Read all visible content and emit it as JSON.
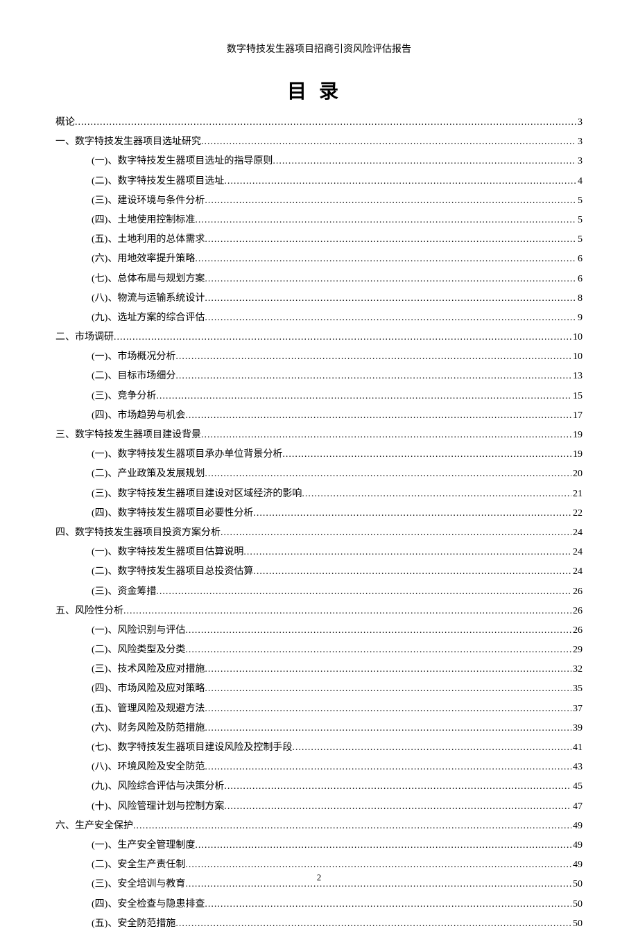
{
  "header": "数字特技发生器项目招商引资风险评估报告",
  "toc_title": "目录",
  "page_number": "2",
  "entries": [
    {
      "level": 0,
      "label": "概论",
      "page": "3"
    },
    {
      "level": 1,
      "label": "一、数字特技发生器项目选址研究",
      "page": "3"
    },
    {
      "level": 2,
      "label": "(一)、数字特技发生器项目选址的指导原则",
      "page": "3"
    },
    {
      "level": 2,
      "label": "(二)、数字特技发生器项目选址",
      "page": "4"
    },
    {
      "level": 2,
      "label": "(三)、建设环境与条件分析",
      "page": "5"
    },
    {
      "level": 2,
      "label": "(四)、土地使用控制标准",
      "page": "5"
    },
    {
      "level": 2,
      "label": "(五)、土地利用的总体需求",
      "page": "5"
    },
    {
      "level": 2,
      "label": "(六)、用地效率提升策略",
      "page": "6"
    },
    {
      "level": 2,
      "label": "(七)、总体布局与规划方案",
      "page": "6"
    },
    {
      "level": 2,
      "label": "(八)、物流与运输系统设计",
      "page": "8"
    },
    {
      "level": 2,
      "label": "(九)、选址方案的综合评估",
      "page": "9"
    },
    {
      "level": 1,
      "label": "二、市场调研",
      "page": "10"
    },
    {
      "level": 2,
      "label": "(一)、市场概况分析",
      "page": "10"
    },
    {
      "level": 2,
      "label": "(二)、目标市场细分",
      "page": "13"
    },
    {
      "level": 2,
      "label": "(三)、竞争分析",
      "page": "15"
    },
    {
      "level": 2,
      "label": "(四)、市场趋势与机会",
      "page": "17"
    },
    {
      "level": 1,
      "label": "三、数字特技发生器项目建设背景",
      "page": "19"
    },
    {
      "level": 2,
      "label": "(一)、数字特技发生器项目承办单位背景分析",
      "page": "19"
    },
    {
      "level": 2,
      "label": "(二)、产业政策及发展规划",
      "page": "20"
    },
    {
      "level": 2,
      "label": "(三)、数字特技发生器项目建设对区域经济的影响",
      "page": "21"
    },
    {
      "level": 2,
      "label": "(四)、数字特技发生器项目必要性分析",
      "page": "22"
    },
    {
      "level": 1,
      "label": "四、数字特技发生器项目投资方案分析",
      "page": "24"
    },
    {
      "level": 2,
      "label": "(一)、数字特技发生器项目估算说明",
      "page": "24"
    },
    {
      "level": 2,
      "label": "(二)、数字特技发生器项目总投资估算",
      "page": "24"
    },
    {
      "level": 2,
      "label": "(三)、资金筹措",
      "page": "26"
    },
    {
      "level": 1,
      "label": "五、风险性分析",
      "page": "26"
    },
    {
      "level": 2,
      "label": "(一)、风险识别与评估",
      "page": "26"
    },
    {
      "level": 2,
      "label": "(二)、风险类型及分类",
      "page": "29"
    },
    {
      "level": 2,
      "label": "(三)、技术风险及应对措施",
      "page": "32"
    },
    {
      "level": 2,
      "label": "(四)、市场风险及应对策略",
      "page": "35"
    },
    {
      "level": 2,
      "label": "(五)、管理风险及规避方法",
      "page": "37"
    },
    {
      "level": 2,
      "label": "(六)、财务风险及防范措施",
      "page": "39"
    },
    {
      "level": 2,
      "label": "(七)、数字特技发生器项目建设风险及控制手段",
      "page": "41"
    },
    {
      "level": 2,
      "label": "(八)、环境风险及安全防范",
      "page": "43"
    },
    {
      "level": 2,
      "label": "(九)、风险综合评估与决策分析",
      "page": "45"
    },
    {
      "level": 2,
      "label": "(十)、风险管理计划与控制方案",
      "page": "47"
    },
    {
      "level": 1,
      "label": "六、生产安全保护",
      "page": "49"
    },
    {
      "level": 2,
      "label": "(一)、生产安全管理制度",
      "page": "49"
    },
    {
      "level": 2,
      "label": "(二)、安全生产责任制",
      "page": "49"
    },
    {
      "level": 2,
      "label": "(三)、安全培训与教育",
      "page": "50"
    },
    {
      "level": 2,
      "label": "(四)、安全检查与隐患排查",
      "page": "50"
    },
    {
      "level": 2,
      "label": "(五)、安全防范措施",
      "page": "50"
    }
  ]
}
